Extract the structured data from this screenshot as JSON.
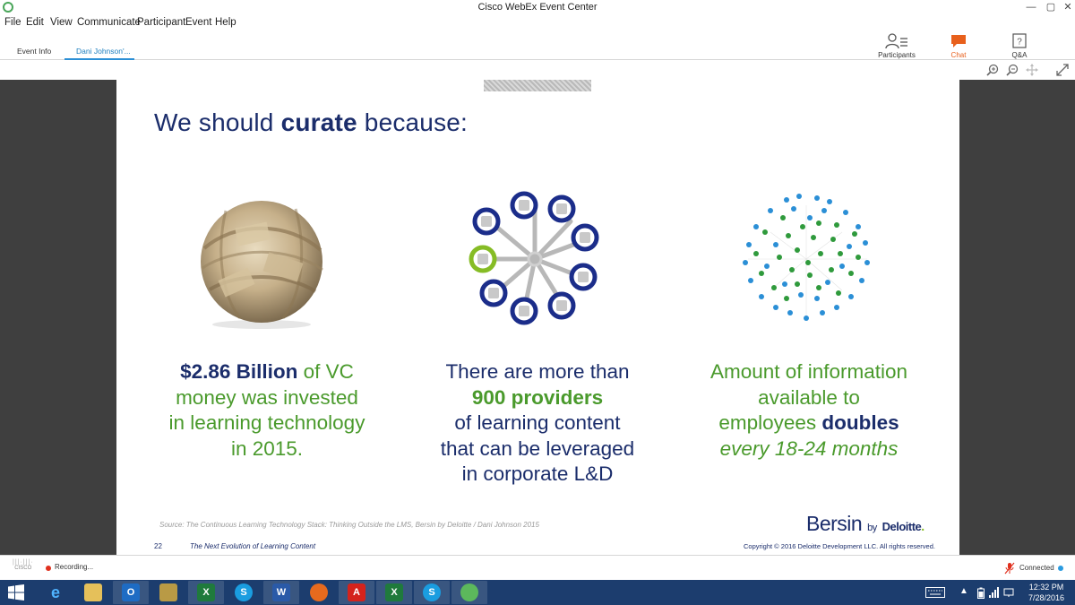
{
  "window": {
    "title": "Cisco WebEx Event Center"
  },
  "menu": [
    "File",
    "Edit",
    "View",
    "Communicate",
    "Participant",
    "Event",
    "Help"
  ],
  "tabs": [
    {
      "label": "Event Info",
      "active": false
    },
    {
      "label": "Dani Johnson'...",
      "active": true
    }
  ],
  "panels": {
    "participants": "Participants",
    "chat": "Chat",
    "qa": "Q&A"
  },
  "slide": {
    "title_pre": "We should ",
    "title_bold": "curate",
    "title_post": " because:",
    "col1": {
      "bold": "$2.86 Billion",
      "rest1": " of VC",
      "line2": "money was invested",
      "line3": "in learning technology",
      "line4": "in 2015."
    },
    "col2": {
      "line1": "There are more than",
      "bold": "900 providers",
      "line3": "of learning content",
      "line4": "that can be leveraged",
      "line5": "in corporate L&D"
    },
    "col3": {
      "line1": "Amount of information",
      "line2": "available to",
      "line3_pre": "employees ",
      "line3_bold": "doubles",
      "line4": "every 18-24 months"
    },
    "source": "Source: The Continuous Learning Technology Stack: Thinking Outside the LMS, Bersin by Deloitte / Dani Johnson 2015",
    "page_number": "22",
    "footer": "The Next Evolution of Learning Content",
    "brand_main": "Bersin",
    "brand_by": "by",
    "brand_company": "Deloitte",
    "brand_dot": ".",
    "copyright": "Copyright © 2016 Deloitte Development LLC. All rights reserved."
  },
  "status": {
    "cisco": "CISCO",
    "recording": "Recording...",
    "connection": "Connected"
  },
  "clock": {
    "time": "12:32 PM",
    "date": "7/28/2016"
  },
  "colors": {
    "navy": "#1b2d6b",
    "green": "#4a9a2c",
    "taskbar": "#1c3d6e",
    "chat_accent": "#e8601c"
  }
}
